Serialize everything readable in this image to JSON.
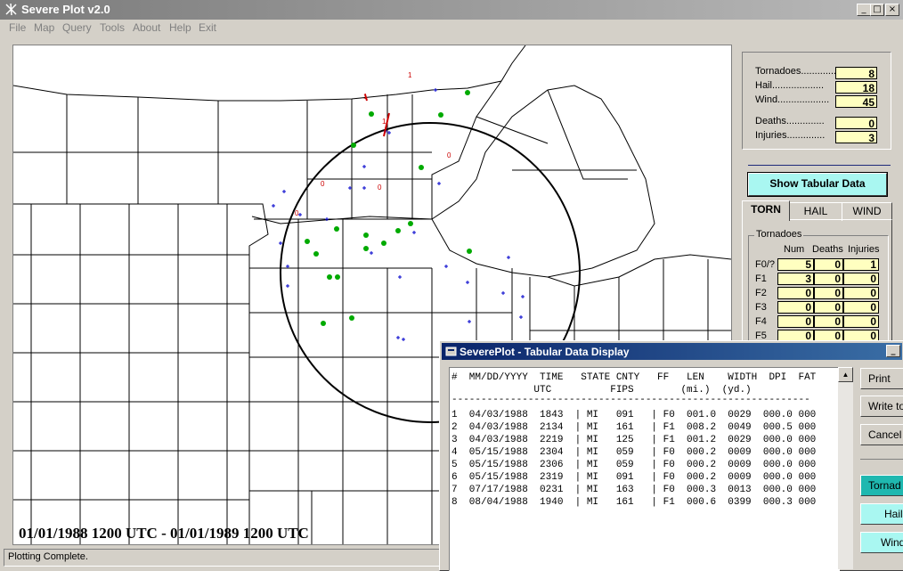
{
  "window": {
    "title": "Severe Plot v2.0",
    "min": "_",
    "max": "□",
    "close": "×"
  },
  "menu": [
    "File",
    "Map",
    "Query",
    "Tools",
    "About",
    "Help",
    "Exit"
  ],
  "map": {
    "date_range": "01/01/1988 1200 UTC - 01/01/1989 1200 UTC",
    "torn_labels": [
      "1",
      "1",
      "1",
      "0",
      "0",
      "0",
      "0"
    ]
  },
  "status": "Plotting Complete.",
  "counts": {
    "tornadoes": {
      "label": "Tornadoes.............",
      "value": "8"
    },
    "hail": {
      "label": "Hail...................",
      "value": "18"
    },
    "wind": {
      "label": "Wind...................",
      "value": "45"
    },
    "deaths": {
      "label": "Deaths..............",
      "value": "0"
    },
    "injuries": {
      "label": "Injuries..............",
      "value": "3"
    }
  },
  "show_tabular": "Show Tabular Data",
  "tabs": [
    "TORN",
    "HAIL",
    "WIND"
  ],
  "torn_panel": {
    "group": "Tornadoes",
    "headers": [
      "Num",
      "Deaths",
      "Injuries"
    ],
    "rows": [
      {
        "label": "F0/?",
        "num": "5",
        "deaths": "0",
        "injuries": "1"
      },
      {
        "label": "F1",
        "num": "3",
        "deaths": "0",
        "injuries": "0"
      },
      {
        "label": "F2",
        "num": "0",
        "deaths": "0",
        "injuries": "0"
      },
      {
        "label": "F3",
        "num": "0",
        "deaths": "0",
        "injuries": "0"
      },
      {
        "label": "F4",
        "num": "0",
        "deaths": "0",
        "injuries": "0"
      },
      {
        "label": "F5",
        "num": "0",
        "deaths": "0",
        "injuries": "0"
      }
    ]
  },
  "dialog": {
    "title": "SeverePlot - Tabular Data Display",
    "header1": "#  MM/DD/YYYY  TIME   STATE CNTY   FF   LEN    WIDTH  DPI  FAT",
    "header2": "              UTC          FIPS        (mi.)  (yd.)",
    "divider": "-------------------------------------------------------------",
    "rows": [
      "1  04/03/1988  1843  | MI   091   | F0  001.0  0029  000.0 000",
      "2  04/03/1988  2134  | MI   161   | F1  008.2  0049  000.5 000",
      "3  04/03/1988  2219  | MI   125   | F1  001.2  0029  000.0 000",
      "4  05/15/1988  2304  | MI   059   | F0  000.2  0009  000.0 000",
      "5  05/15/1988  2306  | MI   059   | F0  000.2  0009  000.0 000",
      "6  05/15/1988  2319  | MI   091   | F0  000.2  0009  000.0 000",
      "7  07/17/1988  0231  | MI   163   | F0  000.3  0013  000.0 000",
      "8  08/04/1988  1940  | MI   161   | F1  000.6  0399  000.3 000"
    ],
    "buttons": [
      "Print",
      "Write to",
      "Cancel"
    ],
    "category_buttons": [
      "Tornad",
      "Hail",
      "Wind"
    ],
    "colors": {
      "tornado_btn": "#1fb8b0",
      "other_btn": "#a9f7f1"
    }
  },
  "colors": {
    "tornado": "#cc0000",
    "hail": "#00aa00",
    "wind": "#0000cc"
  }
}
